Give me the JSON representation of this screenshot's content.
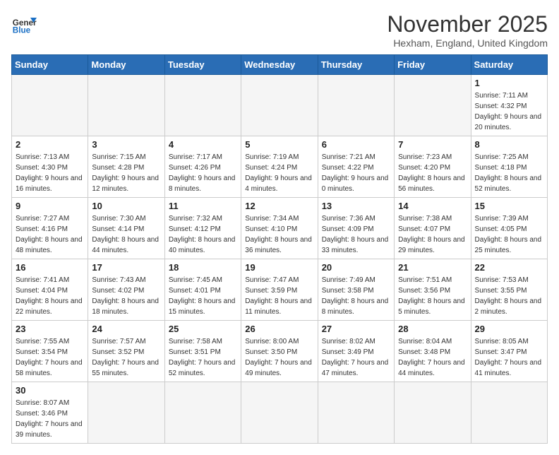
{
  "logo": {
    "text_general": "General",
    "text_blue": "Blue"
  },
  "header": {
    "month": "November 2025",
    "location": "Hexham, England, United Kingdom"
  },
  "weekdays": [
    "Sunday",
    "Monday",
    "Tuesday",
    "Wednesday",
    "Thursday",
    "Friday",
    "Saturday"
  ],
  "weeks": [
    [
      null,
      null,
      null,
      null,
      null,
      null,
      {
        "day": "1",
        "sunrise": "Sunrise: 7:11 AM",
        "sunset": "Sunset: 4:32 PM",
        "daylight": "Daylight: 9 hours and 20 minutes."
      }
    ],
    [
      {
        "day": "2",
        "sunrise": "Sunrise: 7:13 AM",
        "sunset": "Sunset: 4:30 PM",
        "daylight": "Daylight: 9 hours and 16 minutes."
      },
      {
        "day": "3",
        "sunrise": "Sunrise: 7:15 AM",
        "sunset": "Sunset: 4:28 PM",
        "daylight": "Daylight: 9 hours and 12 minutes."
      },
      {
        "day": "4",
        "sunrise": "Sunrise: 7:17 AM",
        "sunset": "Sunset: 4:26 PM",
        "daylight": "Daylight: 9 hours and 8 minutes."
      },
      {
        "day": "5",
        "sunrise": "Sunrise: 7:19 AM",
        "sunset": "Sunset: 4:24 PM",
        "daylight": "Daylight: 9 hours and 4 minutes."
      },
      {
        "day": "6",
        "sunrise": "Sunrise: 7:21 AM",
        "sunset": "Sunset: 4:22 PM",
        "daylight": "Daylight: 9 hours and 0 minutes."
      },
      {
        "day": "7",
        "sunrise": "Sunrise: 7:23 AM",
        "sunset": "Sunset: 4:20 PM",
        "daylight": "Daylight: 8 hours and 56 minutes."
      },
      {
        "day": "8",
        "sunrise": "Sunrise: 7:25 AM",
        "sunset": "Sunset: 4:18 PM",
        "daylight": "Daylight: 8 hours and 52 minutes."
      }
    ],
    [
      {
        "day": "9",
        "sunrise": "Sunrise: 7:27 AM",
        "sunset": "Sunset: 4:16 PM",
        "daylight": "Daylight: 8 hours and 48 minutes."
      },
      {
        "day": "10",
        "sunrise": "Sunrise: 7:30 AM",
        "sunset": "Sunset: 4:14 PM",
        "daylight": "Daylight: 8 hours and 44 minutes."
      },
      {
        "day": "11",
        "sunrise": "Sunrise: 7:32 AM",
        "sunset": "Sunset: 4:12 PM",
        "daylight": "Daylight: 8 hours and 40 minutes."
      },
      {
        "day": "12",
        "sunrise": "Sunrise: 7:34 AM",
        "sunset": "Sunset: 4:10 PM",
        "daylight": "Daylight: 8 hours and 36 minutes."
      },
      {
        "day": "13",
        "sunrise": "Sunrise: 7:36 AM",
        "sunset": "Sunset: 4:09 PM",
        "daylight": "Daylight: 8 hours and 33 minutes."
      },
      {
        "day": "14",
        "sunrise": "Sunrise: 7:38 AM",
        "sunset": "Sunset: 4:07 PM",
        "daylight": "Daylight: 8 hours and 29 minutes."
      },
      {
        "day": "15",
        "sunrise": "Sunrise: 7:39 AM",
        "sunset": "Sunset: 4:05 PM",
        "daylight": "Daylight: 8 hours and 25 minutes."
      }
    ],
    [
      {
        "day": "16",
        "sunrise": "Sunrise: 7:41 AM",
        "sunset": "Sunset: 4:04 PM",
        "daylight": "Daylight: 8 hours and 22 minutes."
      },
      {
        "day": "17",
        "sunrise": "Sunrise: 7:43 AM",
        "sunset": "Sunset: 4:02 PM",
        "daylight": "Daylight: 8 hours and 18 minutes."
      },
      {
        "day": "18",
        "sunrise": "Sunrise: 7:45 AM",
        "sunset": "Sunset: 4:01 PM",
        "daylight": "Daylight: 8 hours and 15 minutes."
      },
      {
        "day": "19",
        "sunrise": "Sunrise: 7:47 AM",
        "sunset": "Sunset: 3:59 PM",
        "daylight": "Daylight: 8 hours and 11 minutes."
      },
      {
        "day": "20",
        "sunrise": "Sunrise: 7:49 AM",
        "sunset": "Sunset: 3:58 PM",
        "daylight": "Daylight: 8 hours and 8 minutes."
      },
      {
        "day": "21",
        "sunrise": "Sunrise: 7:51 AM",
        "sunset": "Sunset: 3:56 PM",
        "daylight": "Daylight: 8 hours and 5 minutes."
      },
      {
        "day": "22",
        "sunrise": "Sunrise: 7:53 AM",
        "sunset": "Sunset: 3:55 PM",
        "daylight": "Daylight: 8 hours and 2 minutes."
      }
    ],
    [
      {
        "day": "23",
        "sunrise": "Sunrise: 7:55 AM",
        "sunset": "Sunset: 3:54 PM",
        "daylight": "Daylight: 7 hours and 58 minutes."
      },
      {
        "day": "24",
        "sunrise": "Sunrise: 7:57 AM",
        "sunset": "Sunset: 3:52 PM",
        "daylight": "Daylight: 7 hours and 55 minutes."
      },
      {
        "day": "25",
        "sunrise": "Sunrise: 7:58 AM",
        "sunset": "Sunset: 3:51 PM",
        "daylight": "Daylight: 7 hours and 52 minutes."
      },
      {
        "day": "26",
        "sunrise": "Sunrise: 8:00 AM",
        "sunset": "Sunset: 3:50 PM",
        "daylight": "Daylight: 7 hours and 49 minutes."
      },
      {
        "day": "27",
        "sunrise": "Sunrise: 8:02 AM",
        "sunset": "Sunset: 3:49 PM",
        "daylight": "Daylight: 7 hours and 47 minutes."
      },
      {
        "day": "28",
        "sunrise": "Sunrise: 8:04 AM",
        "sunset": "Sunset: 3:48 PM",
        "daylight": "Daylight: 7 hours and 44 minutes."
      },
      {
        "day": "29",
        "sunrise": "Sunrise: 8:05 AM",
        "sunset": "Sunset: 3:47 PM",
        "daylight": "Daylight: 7 hours and 41 minutes."
      }
    ],
    [
      {
        "day": "30",
        "sunrise": "Sunrise: 8:07 AM",
        "sunset": "Sunset: 3:46 PM",
        "daylight": "Daylight: 7 hours and 39 minutes."
      },
      null,
      null,
      null,
      null,
      null,
      null
    ]
  ]
}
